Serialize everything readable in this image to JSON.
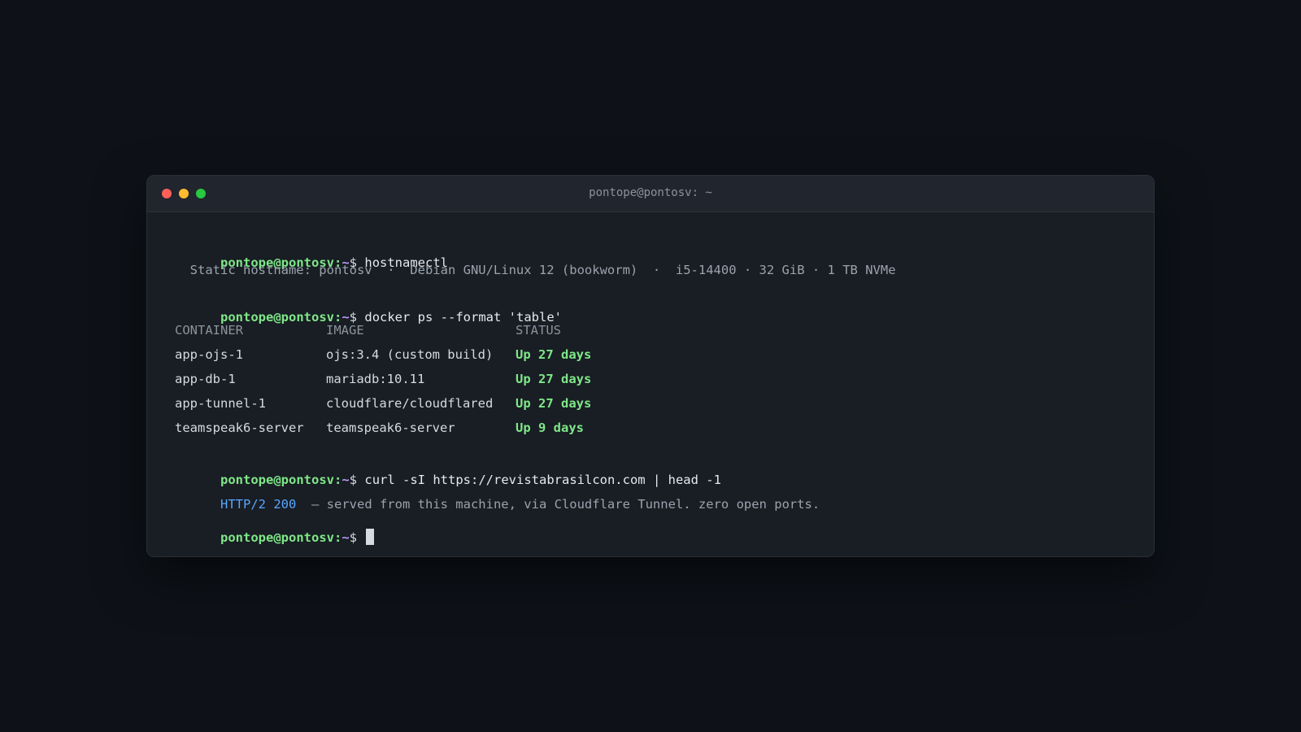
{
  "window": {
    "title": "pontope@pontosv: ~",
    "controls": [
      "close",
      "minimize",
      "maximize"
    ]
  },
  "prompt": {
    "user_host": "pontope@pontosv",
    "colon": ":",
    "path": "~",
    "dollar": "$"
  },
  "commands": [
    "hostnamectl",
    "docker ps --format 'table'",
    "curl -sI https://revistabrasilcon.com | head -1"
  ],
  "hostnamectl_output": "  Static hostname: pontosv  ·  Debian GNU/Linux 12 (bookworm)  ·  i5-14400 · 32 GiB · 1 TB NVMe",
  "docker_table": {
    "headers": [
      "CONTAINER",
      "IMAGE",
      "STATUS"
    ],
    "rows": [
      {
        "container": "app-ojs-1",
        "image": "ojs:3.4 (custom build)",
        "status": "Up 27 days"
      },
      {
        "container": "app-db-1",
        "image": "mariadb:10.11",
        "status": "Up 27 days"
      },
      {
        "container": "app-tunnel-1",
        "image": "cloudflare/cloudflared",
        "status": "Up 27 days"
      },
      {
        "container": "teamspeak6-server",
        "image": "teamspeak6-server",
        "status": "Up 9 days"
      }
    ]
  },
  "curl_output": {
    "status": "HTTP/2 200",
    "note": "  — served from this machine, via Cloudflare Tunnel. zero open ports."
  },
  "colors": {
    "background": "#0e1218",
    "terminal_bg": "#191d24",
    "prompt_user": "#7ee787",
    "prompt_path": "#b59cf5",
    "status_ok": "#7ee787",
    "http": "#58a6ff"
  }
}
